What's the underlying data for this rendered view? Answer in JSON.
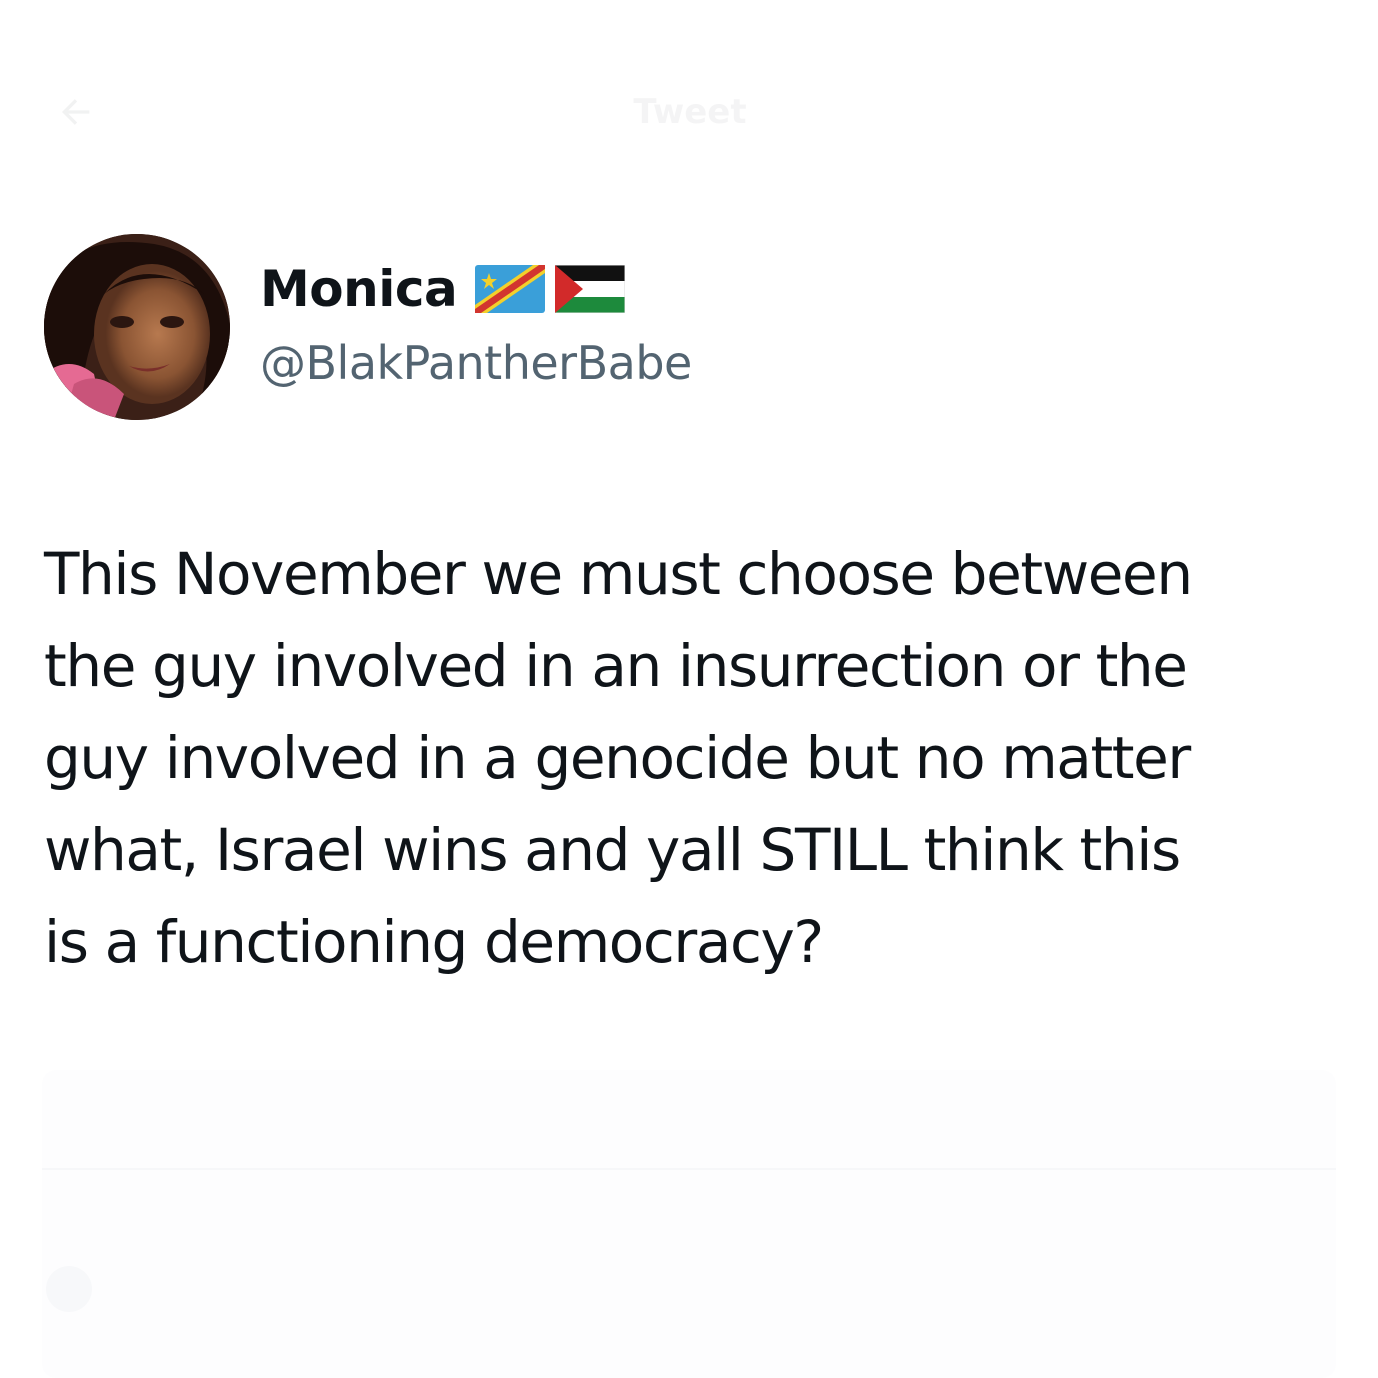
{
  "header": {
    "back_icon": "arrow-left-icon",
    "title": "Tweet"
  },
  "tweet": {
    "author": {
      "display_name": "Monica",
      "flags": [
        "flag-dr-congo-icon",
        "flag-palestine-icon"
      ],
      "handle": "@BlakPantherBabe",
      "avatar": "profile-photo"
    },
    "text": "This November we must choose between\nthe guy involved in an insurrection or the\nguy involved in a genocide but no matter\nwhat, Israel wins and yall STILL think this\nis a functioning democracy?"
  },
  "colors": {
    "text_primary": "#0f1419",
    "text_secondary": "#536471",
    "background": "#ffffff"
  }
}
